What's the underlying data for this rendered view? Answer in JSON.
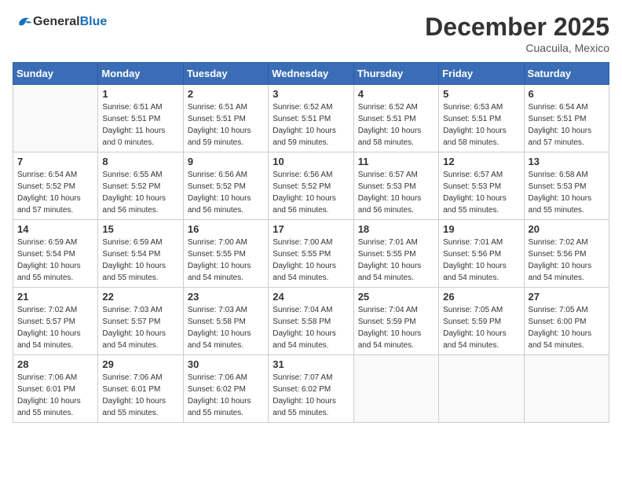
{
  "header": {
    "logo_general": "General",
    "logo_blue": "Blue",
    "month": "December 2025",
    "location": "Cuacuila, Mexico"
  },
  "weekdays": [
    "Sunday",
    "Monday",
    "Tuesday",
    "Wednesday",
    "Thursday",
    "Friday",
    "Saturday"
  ],
  "weeks": [
    [
      {
        "day": "",
        "info": ""
      },
      {
        "day": "1",
        "info": "Sunrise: 6:51 AM\nSunset: 5:51 PM\nDaylight: 11 hours\nand 0 minutes."
      },
      {
        "day": "2",
        "info": "Sunrise: 6:51 AM\nSunset: 5:51 PM\nDaylight: 10 hours\nand 59 minutes."
      },
      {
        "day": "3",
        "info": "Sunrise: 6:52 AM\nSunset: 5:51 PM\nDaylight: 10 hours\nand 59 minutes."
      },
      {
        "day": "4",
        "info": "Sunrise: 6:52 AM\nSunset: 5:51 PM\nDaylight: 10 hours\nand 58 minutes."
      },
      {
        "day": "5",
        "info": "Sunrise: 6:53 AM\nSunset: 5:51 PM\nDaylight: 10 hours\nand 58 minutes."
      },
      {
        "day": "6",
        "info": "Sunrise: 6:54 AM\nSunset: 5:51 PM\nDaylight: 10 hours\nand 57 minutes."
      }
    ],
    [
      {
        "day": "7",
        "info": "Sunrise: 6:54 AM\nSunset: 5:52 PM\nDaylight: 10 hours\nand 57 minutes."
      },
      {
        "day": "8",
        "info": "Sunrise: 6:55 AM\nSunset: 5:52 PM\nDaylight: 10 hours\nand 56 minutes."
      },
      {
        "day": "9",
        "info": "Sunrise: 6:56 AM\nSunset: 5:52 PM\nDaylight: 10 hours\nand 56 minutes."
      },
      {
        "day": "10",
        "info": "Sunrise: 6:56 AM\nSunset: 5:52 PM\nDaylight: 10 hours\nand 56 minutes."
      },
      {
        "day": "11",
        "info": "Sunrise: 6:57 AM\nSunset: 5:53 PM\nDaylight: 10 hours\nand 56 minutes."
      },
      {
        "day": "12",
        "info": "Sunrise: 6:57 AM\nSunset: 5:53 PM\nDaylight: 10 hours\nand 55 minutes."
      },
      {
        "day": "13",
        "info": "Sunrise: 6:58 AM\nSunset: 5:53 PM\nDaylight: 10 hours\nand 55 minutes."
      }
    ],
    [
      {
        "day": "14",
        "info": "Sunrise: 6:59 AM\nSunset: 5:54 PM\nDaylight: 10 hours\nand 55 minutes."
      },
      {
        "day": "15",
        "info": "Sunrise: 6:59 AM\nSunset: 5:54 PM\nDaylight: 10 hours\nand 55 minutes."
      },
      {
        "day": "16",
        "info": "Sunrise: 7:00 AM\nSunset: 5:55 PM\nDaylight: 10 hours\nand 54 minutes."
      },
      {
        "day": "17",
        "info": "Sunrise: 7:00 AM\nSunset: 5:55 PM\nDaylight: 10 hours\nand 54 minutes."
      },
      {
        "day": "18",
        "info": "Sunrise: 7:01 AM\nSunset: 5:55 PM\nDaylight: 10 hours\nand 54 minutes."
      },
      {
        "day": "19",
        "info": "Sunrise: 7:01 AM\nSunset: 5:56 PM\nDaylight: 10 hours\nand 54 minutes."
      },
      {
        "day": "20",
        "info": "Sunrise: 7:02 AM\nSunset: 5:56 PM\nDaylight: 10 hours\nand 54 minutes."
      }
    ],
    [
      {
        "day": "21",
        "info": "Sunrise: 7:02 AM\nSunset: 5:57 PM\nDaylight: 10 hours\nand 54 minutes."
      },
      {
        "day": "22",
        "info": "Sunrise: 7:03 AM\nSunset: 5:57 PM\nDaylight: 10 hours\nand 54 minutes."
      },
      {
        "day": "23",
        "info": "Sunrise: 7:03 AM\nSunset: 5:58 PM\nDaylight: 10 hours\nand 54 minutes."
      },
      {
        "day": "24",
        "info": "Sunrise: 7:04 AM\nSunset: 5:58 PM\nDaylight: 10 hours\nand 54 minutes."
      },
      {
        "day": "25",
        "info": "Sunrise: 7:04 AM\nSunset: 5:59 PM\nDaylight: 10 hours\nand 54 minutes."
      },
      {
        "day": "26",
        "info": "Sunrise: 7:05 AM\nSunset: 5:59 PM\nDaylight: 10 hours\nand 54 minutes."
      },
      {
        "day": "27",
        "info": "Sunrise: 7:05 AM\nSunset: 6:00 PM\nDaylight: 10 hours\nand 54 minutes."
      }
    ],
    [
      {
        "day": "28",
        "info": "Sunrise: 7:06 AM\nSunset: 6:01 PM\nDaylight: 10 hours\nand 55 minutes."
      },
      {
        "day": "29",
        "info": "Sunrise: 7:06 AM\nSunset: 6:01 PM\nDaylight: 10 hours\nand 55 minutes."
      },
      {
        "day": "30",
        "info": "Sunrise: 7:06 AM\nSunset: 6:02 PM\nDaylight: 10 hours\nand 55 minutes."
      },
      {
        "day": "31",
        "info": "Sunrise: 7:07 AM\nSunset: 6:02 PM\nDaylight: 10 hours\nand 55 minutes."
      },
      {
        "day": "",
        "info": ""
      },
      {
        "day": "",
        "info": ""
      },
      {
        "day": "",
        "info": ""
      }
    ]
  ]
}
